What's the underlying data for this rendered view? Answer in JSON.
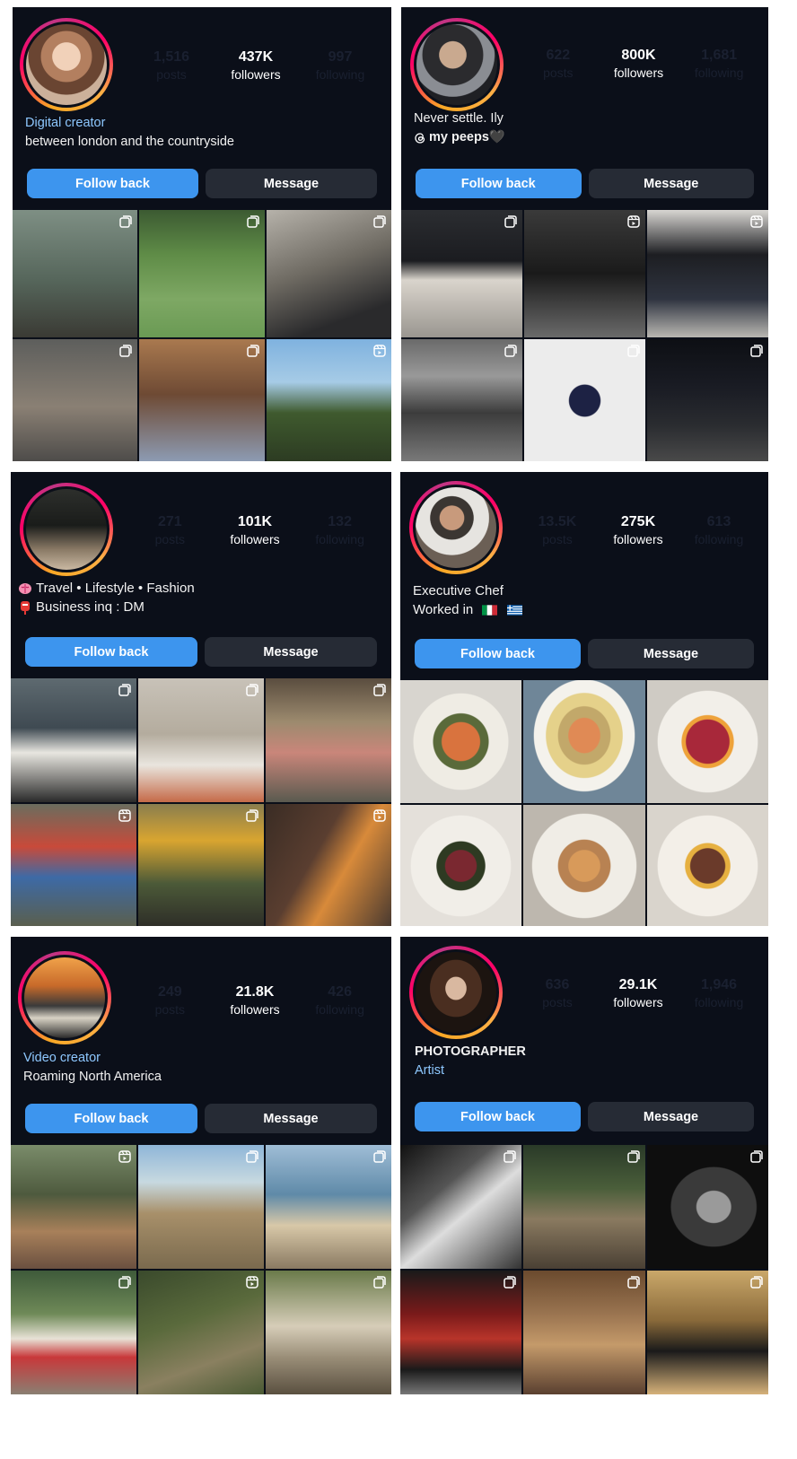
{
  "profiles": [
    {
      "stats": {
        "posts_num": "1,516",
        "posts_label": "posts",
        "followers_num": "437K",
        "followers_label": "followers",
        "following_num": "997",
        "following_label": "following"
      },
      "bio": {
        "category": "Digital creator",
        "line1": "between london and the countryside"
      },
      "buttons": {
        "follow": "Follow back",
        "message": "Message"
      }
    },
    {
      "stats": {
        "posts_num": "622",
        "posts_label": "posts",
        "followers_num": "800K",
        "followers_label": "followers",
        "following_num": "1,681",
        "following_label": "following"
      },
      "bio": {
        "line1": "Never settle. Ily",
        "line2": "my peeps🖤"
      },
      "buttons": {
        "follow": "Follow back",
        "message": "Message"
      }
    },
    {
      "stats": {
        "posts_num": "271",
        "posts_label": "posts",
        "followers_num": "101K",
        "followers_label": "followers",
        "following_num": "132",
        "following_label": "following"
      },
      "bio": {
        "line1": "Travel • Lifestyle • Fashion",
        "line2": "Business inq : DM"
      },
      "buttons": {
        "follow": "Follow back",
        "message": "Message"
      }
    },
    {
      "stats": {
        "posts_num": "13.5K",
        "posts_label": "posts",
        "followers_num": "275K",
        "followers_label": "followers",
        "following_num": "613",
        "following_label": "following"
      },
      "bio": {
        "line1": "Executive Chef",
        "line2": "Worked in"
      },
      "buttons": {
        "follow": "Follow back",
        "message": "Message"
      }
    },
    {
      "stats": {
        "posts_num": "249",
        "posts_label": "posts",
        "followers_num": "21.8K",
        "followers_label": "followers",
        "following_num": "426",
        "following_label": "following"
      },
      "bio": {
        "category": "Video creator",
        "line1": "Roaming North America"
      },
      "buttons": {
        "follow": "Follow back",
        "message": "Message"
      }
    },
    {
      "stats": {
        "posts_num": "636",
        "posts_label": "posts",
        "followers_num": "29.1K",
        "followers_label": "followers",
        "following_num": "1,946",
        "following_label": "following"
      },
      "bio": {
        "line1": "PHOTOGRAPHER",
        "category": "Artist"
      },
      "buttons": {
        "follow": "Follow back",
        "message": "Message"
      }
    }
  ],
  "colors": {
    "panel_bg": "#0b0f19",
    "follow_button": "#3d95ee",
    "message_button": "#262b35",
    "category_text": "#8ec8ff"
  }
}
